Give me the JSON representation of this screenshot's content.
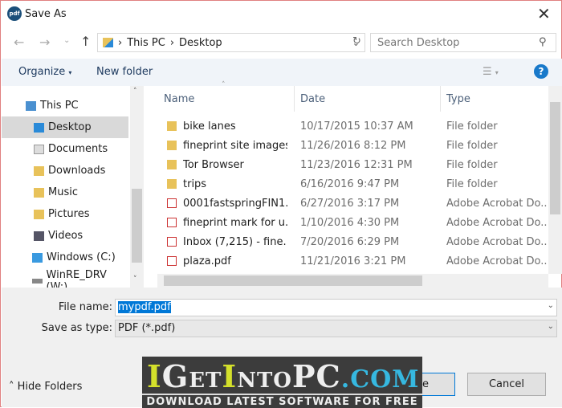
{
  "window": {
    "title": "Save As",
    "app_icon": "pdf"
  },
  "address": {
    "path": [
      "This PC",
      "Desktop"
    ],
    "search_placeholder": "Search Desktop"
  },
  "toolbar": {
    "organize": "Organize",
    "new_folder": "New folder",
    "help": "?"
  },
  "sidebar": {
    "items": [
      {
        "label": "This PC",
        "icon": "computer-icon"
      },
      {
        "label": "Desktop",
        "icon": "desktop-icon",
        "selected": true
      },
      {
        "label": "Documents",
        "icon": "documents-icon"
      },
      {
        "label": "Downloads",
        "icon": "downloads-icon"
      },
      {
        "label": "Music",
        "icon": "music-icon"
      },
      {
        "label": "Pictures",
        "icon": "pictures-icon"
      },
      {
        "label": "Videos",
        "icon": "videos-icon"
      },
      {
        "label": "Windows (C:)",
        "icon": "drive-icon"
      },
      {
        "label": "WinRE_DRV (W:)",
        "icon": "drive-icon"
      }
    ]
  },
  "columns": {
    "name": "Name",
    "date": "Date",
    "type": "Type"
  },
  "files": [
    {
      "name": "bike lanes",
      "date": "10/17/2015 10:37 AM",
      "type": "File folder",
      "kind": "folder"
    },
    {
      "name": "fineprint site images",
      "date": "11/26/2016 8:12 PM",
      "type": "File folder",
      "kind": "folder"
    },
    {
      "name": "Tor Browser",
      "date": "11/23/2016 12:31 PM",
      "type": "File folder",
      "kind": "folder"
    },
    {
      "name": "trips",
      "date": "6/16/2016 9:47 PM",
      "type": "File folder",
      "kind": "folder"
    },
    {
      "name": "0001fastspringFIN1...",
      "date": "6/27/2016 3:17 PM",
      "type": "Adobe Acrobat Do...",
      "kind": "pdf"
    },
    {
      "name": "fineprint mark for u...",
      "date": "1/10/2016 4:30 PM",
      "type": "Adobe Acrobat Do...",
      "kind": "pdf"
    },
    {
      "name": "Inbox (7,215) - fine...",
      "date": "7/20/2016 6:29 PM",
      "type": "Adobe Acrobat Do...",
      "kind": "pdf"
    },
    {
      "name": "plaza.pdf",
      "date": "11/21/2016 3:21 PM",
      "type": "Adobe Acrobat Do...",
      "kind": "pdf"
    }
  ],
  "form": {
    "file_name_label": "File name:",
    "file_name": "mypdf.pdf",
    "type_label": "Save as type:",
    "type_value": "PDF (*.pdf)"
  },
  "footer": {
    "hide_folders": "Hide Folders",
    "save": "Save",
    "cancel": "Cancel"
  },
  "watermark": {
    "brand": "IGetIntoPC.com",
    "tagline": "Download Latest Software for Free"
  }
}
